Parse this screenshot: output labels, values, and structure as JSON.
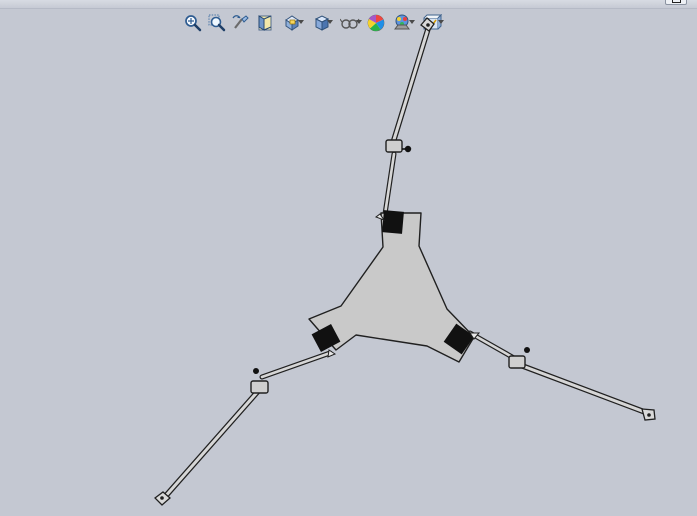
{
  "window": {
    "title": ""
  },
  "graphics_area": {
    "background_color": "#c4c8d2",
    "model": {
      "plate_color": "#c9c9c9",
      "outline_color": "#202020",
      "fixture_color": "#111111",
      "arm_color": "#d6d6d6"
    }
  },
  "toolbar": {
    "buttons": [
      {
        "name": "zoom-to-fit",
        "icon": "zoom-to-fit-icon",
        "has_dropdown": false
      },
      {
        "name": "zoom-to-area",
        "icon": "zoom-to-area-icon",
        "has_dropdown": false
      },
      {
        "name": "previous-view",
        "icon": "previous-view-icon",
        "has_dropdown": false
      },
      {
        "name": "section-view",
        "icon": "section-view-icon",
        "has_dropdown": false
      },
      {
        "name": "view-orientation",
        "icon": "view-orientation-icon",
        "has_dropdown": true
      },
      {
        "name": "display-style",
        "icon": "display-style-icon",
        "has_dropdown": true
      },
      {
        "name": "hide-show-items",
        "icon": "hide-show-items-icon",
        "has_dropdown": true
      },
      {
        "name": "edit-appearance",
        "icon": "edit-appearance-icon",
        "has_dropdown": false
      },
      {
        "name": "apply-scene",
        "icon": "apply-scene-icon",
        "has_dropdown": true
      },
      {
        "name": "view-settings",
        "icon": "view-settings-icon",
        "has_dropdown": true
      }
    ]
  }
}
